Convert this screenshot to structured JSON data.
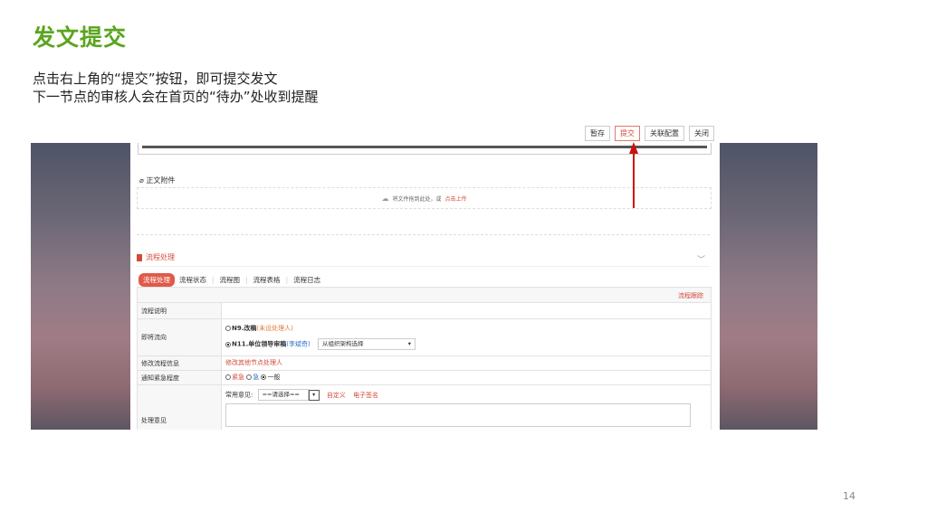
{
  "slide": {
    "title": "发文提交",
    "line1": "点击右上角的“提交”按钮，即可提交发文",
    "line2": "下一节点的审核人会在首页的“待办”处收到提醒",
    "page_number": "14"
  },
  "toolbar": {
    "save": "暂存",
    "submit": "提交",
    "config": "关联配置",
    "close": "关闭"
  },
  "attachment": {
    "label": "正文附件",
    "drop_text": "将文件拖到此处，或",
    "upload_link": "点击上传"
  },
  "process": {
    "section_title": "流程处理",
    "tabs": [
      "流程处理",
      "流程状态",
      "流程图",
      "流程表格",
      "流程日志"
    ],
    "follow_link": "流程跟踪",
    "rows": {
      "desc_label": "流程说明",
      "flow_label": "即将流向",
      "n9_text": "N9.改稿",
      "n9_note": "(未设处理人)",
      "n11_text": "N11.单位领导审稿",
      "n11_person": "(李斌奇)",
      "n11_select": "从组织架构选择",
      "modify_label": "修改流程信息",
      "modify_link": "修改其他节点处理人",
      "urgency_label": "通知紧急程度",
      "urgency_options": [
        "紧急",
        "急",
        "一般"
      ],
      "opinion_label": "处理意见",
      "common_label": "常用意见:",
      "common_select": "==请选择==",
      "custom_link": "自定义",
      "sign_link": "电子签名"
    }
  },
  "colors": {
    "title_green": "#5aa51e",
    "accent_red": "#d24b3a",
    "arrow_red": "#cc1010"
  }
}
